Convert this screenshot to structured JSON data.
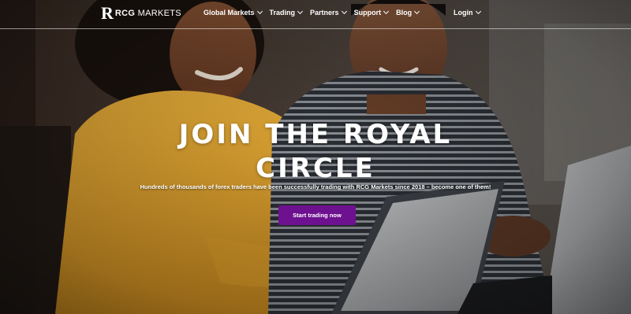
{
  "brand": {
    "logo_mark": "R",
    "name_bold": "RCG",
    "name_rest": " MARKETS"
  },
  "nav": {
    "items": [
      {
        "label": "Global Markets"
      },
      {
        "label": "Trading"
      },
      {
        "label": "Partners"
      },
      {
        "label": "Support"
      },
      {
        "label": "Blog"
      }
    ],
    "login_label": "Login"
  },
  "hero": {
    "headline_line1": "JOIN THE ROYAL",
    "headline_line2": "CIRCLE",
    "subtitle": "Hundreds of thousands of forex traders have been successfully trading with RCG Markets since 2018 – become one of them!",
    "cta_label": "Start trading now"
  },
  "colors": {
    "cta_background": "#6e1190",
    "text": "#ffffff",
    "sweater": "#e2a32c"
  },
  "icons": {
    "dropdown": "chevron-down-icon"
  }
}
